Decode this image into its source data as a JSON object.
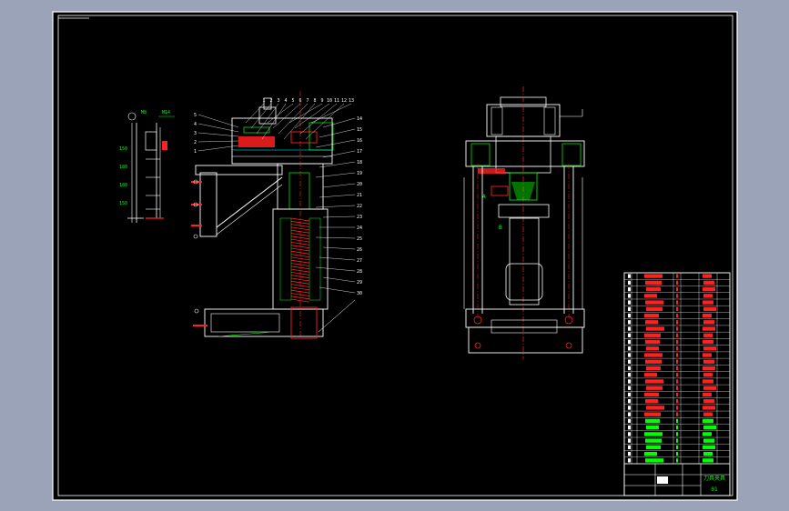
{
  "drawing": {
    "background_color": "#9aa3b8",
    "sheet_color": "#000000",
    "line_colors": {
      "white": "#ffffff",
      "green": "#00ff00",
      "red": "#ff2020",
      "magenta": "#ff00ff",
      "cyan": "#00ffff",
      "yellow": "#ffff00"
    },
    "left_view": {
      "dims": [
        "150",
        "180",
        "180",
        "150"
      ],
      "top_labels": [
        "M8",
        "M14"
      ],
      "callouts_top": [
        "1",
        "2",
        "3",
        "4",
        "5",
        "6",
        "7",
        "8",
        "9",
        "10",
        "11",
        "12",
        "13"
      ],
      "callouts_left": [
        "5",
        "4",
        "3",
        "2",
        "1"
      ],
      "callouts_right": [
        "14",
        "15",
        "16",
        "17",
        "18",
        "19",
        "20",
        "21",
        "22",
        "23",
        "24",
        "25",
        "26",
        "27",
        "28",
        "29",
        "30"
      ]
    },
    "right_view": {
      "labels": [
        "A",
        "B"
      ]
    },
    "title_block": {
      "title": "刀具夹具",
      "drawing_no": "01",
      "rows": 29
    }
  }
}
